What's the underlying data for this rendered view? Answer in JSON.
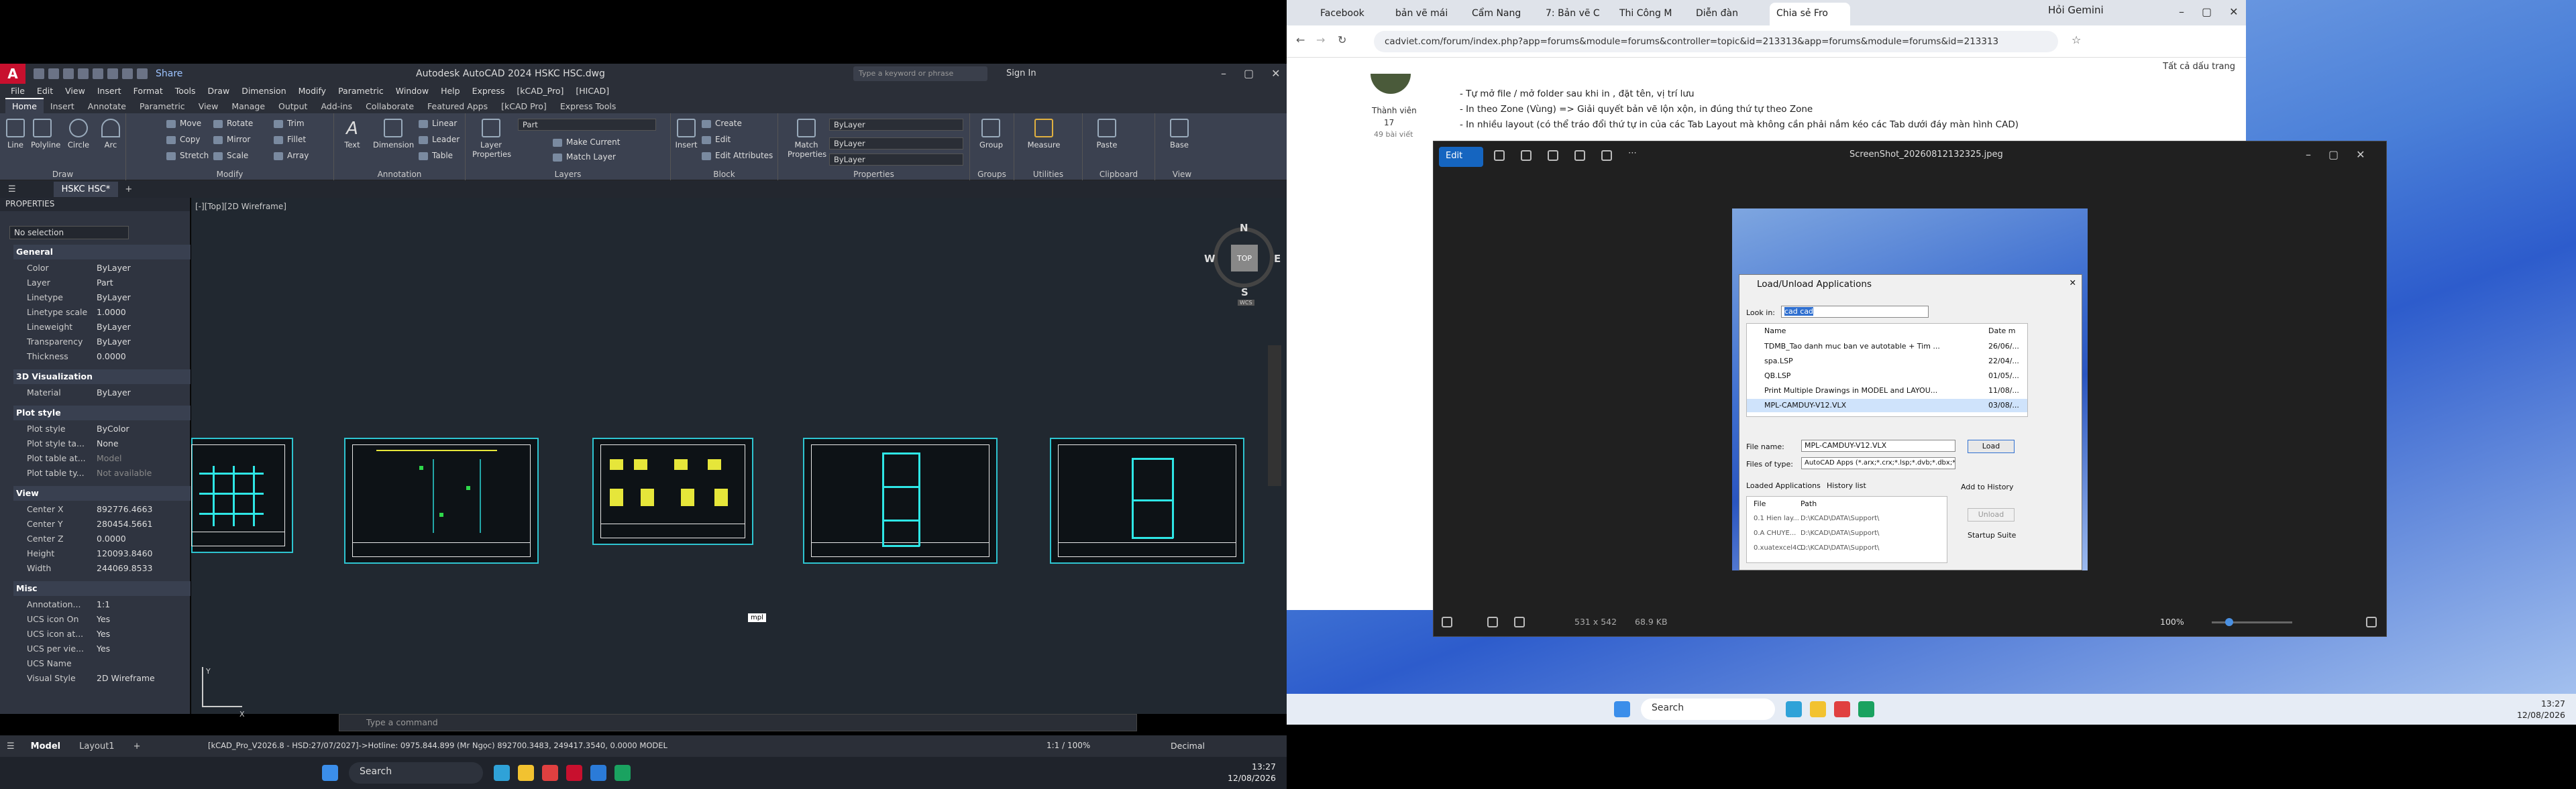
{
  "acad": {
    "title": "Autodesk AutoCAD 2024    HSKC HSC.dwg",
    "share_label": "Share",
    "search_placeholder": "Type a keyword or phrase",
    "sign_in": "Sign In",
    "menus": [
      "File",
      "Edit",
      "View",
      "Insert",
      "Format",
      "Tools",
      "Draw",
      "Dimension",
      "Modify",
      "Parametric",
      "Window",
      "Help",
      "Express",
      "[kCAD_Pro]",
      "[HICAD]"
    ],
    "ribbon_tabs": [
      "Home",
      "Insert",
      "Annotate",
      "Parametric",
      "View",
      "Manage",
      "Output",
      "Add-ins",
      "Collaborate",
      "Featured Apps",
      "[kCAD Pro]",
      "Express Tools"
    ],
    "active_tab": "Home",
    "draw_tools": [
      "Line",
      "Polyline",
      "Circle",
      "Arc"
    ],
    "draw_label": "Draw",
    "modify_tools": [
      "Move",
      "Rotate",
      "Trim",
      "Copy",
      "Mirror",
      "Fillet",
      "Stretch",
      "Scale",
      "Array"
    ],
    "modify_label": "Modify",
    "annotation_tools": [
      "Text",
      "Dimension",
      "Linear",
      "Leader",
      "Table"
    ],
    "annotation_label": "Annotation",
    "layer_props": "Layer Properties",
    "layer_current": "Part",
    "layer_tools": [
      "Make Current",
      "Match Layer"
    ],
    "layers_label": "Layers",
    "block_tools": [
      "Insert",
      "Create",
      "Edit",
      "Edit Attributes"
    ],
    "block_label": "Block",
    "match_props": "Match Properties",
    "bylayer": "ByLayer",
    "properties_label": "Properties",
    "groups_label": "Groups",
    "group_label": "Group",
    "measure_label": "Measure",
    "utilities_label": "Utilities",
    "paste_label": "Paste",
    "clipboard_label": "Clipboard",
    "base_label": "Base",
    "view_label": "View",
    "file_tab": "HSKC HSC*",
    "props_title": "PROPERTIES",
    "selection": "No selection",
    "sections": {
      "general": {
        "title": "General",
        "rows": [
          [
            "Color",
            "ByLayer"
          ],
          [
            "Layer",
            "Part"
          ],
          [
            "Linetype",
            "ByLayer"
          ],
          [
            "Linetype scale",
            "1.0000"
          ],
          [
            "Lineweight",
            "ByLayer"
          ],
          [
            "Transparency",
            "ByLayer"
          ],
          [
            "Thickness",
            "0.0000"
          ]
        ]
      },
      "viz": {
        "title": "3D Visualization",
        "rows": [
          [
            "Material",
            "ByLayer"
          ]
        ]
      },
      "plot": {
        "title": "Plot style",
        "rows": [
          [
            "Plot style",
            "ByColor"
          ],
          [
            "Plot style ta...",
            "None"
          ],
          [
            "Plot table at...",
            "Model"
          ],
          [
            "Plot table ty...",
            "Not available"
          ]
        ]
      },
      "view": {
        "title": "View",
        "rows": [
          [
            "Center X",
            "892776.4663"
          ],
          [
            "Center Y",
            "280454.5661"
          ],
          [
            "Center Z",
            "0.0000"
          ],
          [
            "Height",
            "120093.8460"
          ],
          [
            "Width",
            "244069.8533"
          ]
        ]
      },
      "misc": {
        "title": "Misc",
        "rows": [
          [
            "Annotation...",
            "1:1"
          ],
          [
            "UCS icon On",
            "Yes"
          ],
          [
            "UCS icon at...",
            "Yes"
          ],
          [
            "UCS per vie...",
            "Yes"
          ],
          [
            "UCS Name",
            ""
          ],
          [
            "Visual Style",
            "2D Wireframe"
          ]
        ]
      }
    },
    "viewport_label": "[-][Top][2D Wireframe]",
    "cube": {
      "n": "N",
      "s": "S",
      "e": "E",
      "w": "W",
      "top": "TOP",
      "wcs": "WCS"
    },
    "tooltip": "mpl",
    "command_placeholder": "Type a command",
    "status_model": "Model",
    "status_layout": "Layout1",
    "status_coords": "[kCAD_Pro_V2026.8 - HSD:27/07/2027]->Hotline: 0975.844.899 (Mr Ngọc)     892700.3483, 249417.3540, 0.0000   MODEL",
    "decimal": "Decimal",
    "scale": "1:1 / 100%"
  },
  "taskbar_left": {
    "search": "Search",
    "time": "13:27",
    "date": "12/08/2026"
  },
  "taskbar_right": {
    "search": "Search",
    "time": "13:27",
    "date": "12/08/2026"
  },
  "chrome": {
    "tabs": [
      "Facebook",
      "bản vẽ mái",
      "Cẩm Nang",
      "7: Bản vẽ C",
      "Thi Công M",
      "Diễn đàn",
      "Chia sẻ Fro"
    ],
    "gemini": "Hỏi Gemini",
    "url": "cadviet.com/forum/index.php?app=forums&module=forums&controller=topic&id=213313&app=forums&module=forums&id=213313",
    "bookmarks": "Tất cả dấu trang",
    "user_role": "Thành viên",
    "user_count": "17",
    "user_posts": "49 bài viết",
    "bullets": [
      "- Tự mở file / mở folder sau khi in , đặt tên, vị trí lưu",
      "- In theo Zone (Vùng) => Giải quyết bản vẽ lộn xộn, in đúng thứ tự theo Zone",
      "- In nhiều layout (có thể tráo đổi thứ tự in của các Tab Layout mà không cần phải nắm kéo các Tab dưới đáy màn hình CAD)"
    ]
  },
  "viewer": {
    "edit": "Edit",
    "filename": "ScreenShot_20260812132325.jpeg",
    "dims": "531 x 542",
    "size": "68.9 KB",
    "zoom": "100%",
    "dialog": {
      "title": "Load/Unload Applications",
      "lookin": "Look in:",
      "folder": "cad cad",
      "col_name": "Name",
      "col_date": "Date m",
      "files": [
        [
          "TDMB_Tao danh muc ban ve autotable + Tim ...",
          "26/06/..."
        ],
        [
          "spa.LSP",
          "22/04/..."
        ],
        [
          "QB.LSP",
          "01/05/..."
        ],
        [
          "Print Multiple Drawings in MODEL and LAYOU...",
          "11/08/..."
        ],
        [
          "MPL-CAMDUY-V12.VLX",
          "03/08/..."
        ]
      ],
      "filename_label": "File name:",
      "filename_val": "MPL-CAMDUY-V12.VLX",
      "filetype_label": "Files of type:",
      "filetype_val": "AutoCAD Apps (*.arx;*.crx;*.lsp;*.dvb;*.dbx;*.",
      "load": "Load",
      "loaded_tab": "Loaded Applications",
      "history_tab": "History list",
      "add_history": "Add to History",
      "col_file": "File",
      "col_path": "Path",
      "loaded": [
        [
          "0.1 Hien lay...",
          "D:\\KCAD\\DATA\\Support\\"
        ],
        [
          "0.A CHUYE...",
          "D:\\KCAD\\DATA\\Support\\"
        ],
        [
          "0.xuatexcel4C...",
          "D:\\KCAD\\DATA\\Support\\"
        ]
      ],
      "unload": "Unload",
      "startup": "Startup Suite"
    }
  }
}
